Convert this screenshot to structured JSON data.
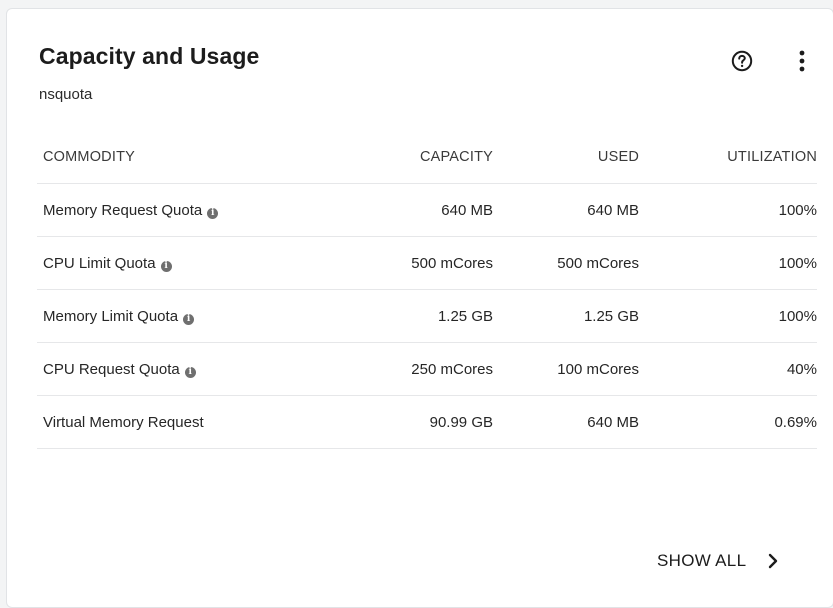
{
  "card": {
    "title": "Capacity and Usage",
    "subtitle": "nsquota",
    "icons": {
      "help": "help-circle-icon",
      "more": "more-vertical-icon"
    }
  },
  "table": {
    "headers": [
      "COMMODITY",
      "CAPACITY",
      "USED",
      "UTILIZATION"
    ],
    "rows": [
      {
        "commodity": "Memory Request Quota",
        "info": true,
        "capacity": "640 MB",
        "used": "640 MB",
        "utilization": "100%"
      },
      {
        "commodity": "CPU Limit Quota",
        "info": true,
        "capacity": "500 mCores",
        "used": "500 mCores",
        "utilization": "100%"
      },
      {
        "commodity": "Memory Limit Quota",
        "info": true,
        "capacity": "1.25 GB",
        "used": "1.25 GB",
        "utilization": "100%"
      },
      {
        "commodity": "CPU Request Quota",
        "info": true,
        "capacity": "250 mCores",
        "used": "100 mCores",
        "utilization": "40%"
      },
      {
        "commodity": "Virtual Memory Request",
        "info": false,
        "capacity": "90.99 GB",
        "used": "640 MB",
        "utilization": "0.69%"
      }
    ]
  },
  "footer": {
    "show_all_label": "SHOW ALL",
    "icon": "chevron-right-icon"
  }
}
